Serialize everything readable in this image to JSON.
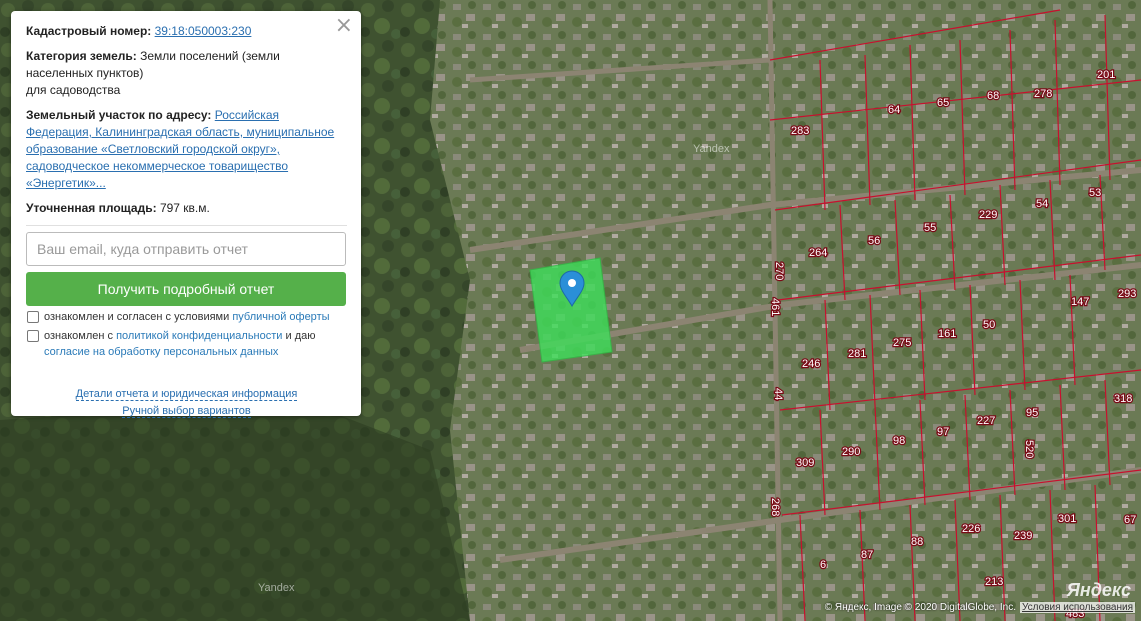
{
  "panel": {
    "close_label": "×",
    "cadastral_label": "Кадастровый номер:",
    "cadastral_value": "39:18:050003:230",
    "category_label": "Категория земель:",
    "category_value_1": "Земли поселений (земли населенных пунктов)",
    "category_value_2": "для садоводства",
    "address_label": "Земельный участок по адресу:",
    "address_value": "Российская Федерация, Калининградская область, муниципальное образование «Светловский городской округ», садоводческое некоммерческое товарищество «Энергетик»...",
    "area_label": "Уточненная площадь:",
    "area_value": "797 кв.м.",
    "email_placeholder": "Ваш email, куда отправить отчет",
    "submit_label": "Получить подробный отчет",
    "consent1_text": "ознакомлен и согласен с условиями",
    "consent1_link": "публичной оферты",
    "consent2_text": "ознакомлен с",
    "consent2_link": "политикой конфиденциальности",
    "consent2_text2": "и даю",
    "consent2_link2": "согласие на обработку персональных данных",
    "details_link": "Детали отчета и юридическая информация",
    "manual_link": "Ручной выбор вариантов"
  },
  "map": {
    "watermarks": [
      "Yandex",
      "Yandex"
    ],
    "copyright": "© Яндекс, Image © 2020 DigitalGlobe, Inc.",
    "terms": "Условия использования",
    "logo": "Яндекс",
    "parcel_color": "#3ee05a",
    "boundary_color": "#c8102e",
    "marker_color": "#2a8fd8",
    "parcels": [
      {
        "label": "201"
      },
      {
        "label": "283"
      },
      {
        "label": "64"
      },
      {
        "label": "65"
      },
      {
        "label": "68"
      },
      {
        "label": "278"
      },
      {
        "label": "53"
      },
      {
        "label": "54"
      },
      {
        "label": "229"
      },
      {
        "label": "55"
      },
      {
        "label": "56"
      },
      {
        "label": "264"
      },
      {
        "label": "270"
      },
      {
        "label": "461"
      },
      {
        "label": "293"
      },
      {
        "label": "147"
      },
      {
        "label": "50"
      },
      {
        "label": "161"
      },
      {
        "label": "275"
      },
      {
        "label": "281"
      },
      {
        "label": "246"
      },
      {
        "label": "44"
      },
      {
        "label": "318"
      },
      {
        "label": "95"
      },
      {
        "label": "520"
      },
      {
        "label": "227"
      },
      {
        "label": "97"
      },
      {
        "label": "98"
      },
      {
        "label": "290"
      },
      {
        "label": "309"
      },
      {
        "label": "268"
      },
      {
        "label": "67"
      },
      {
        "label": "301"
      },
      {
        "label": "239"
      },
      {
        "label": "226"
      },
      {
        "label": "88"
      },
      {
        "label": "87"
      },
      {
        "label": "6"
      },
      {
        "label": "213"
      },
      {
        "label": "483"
      }
    ]
  }
}
